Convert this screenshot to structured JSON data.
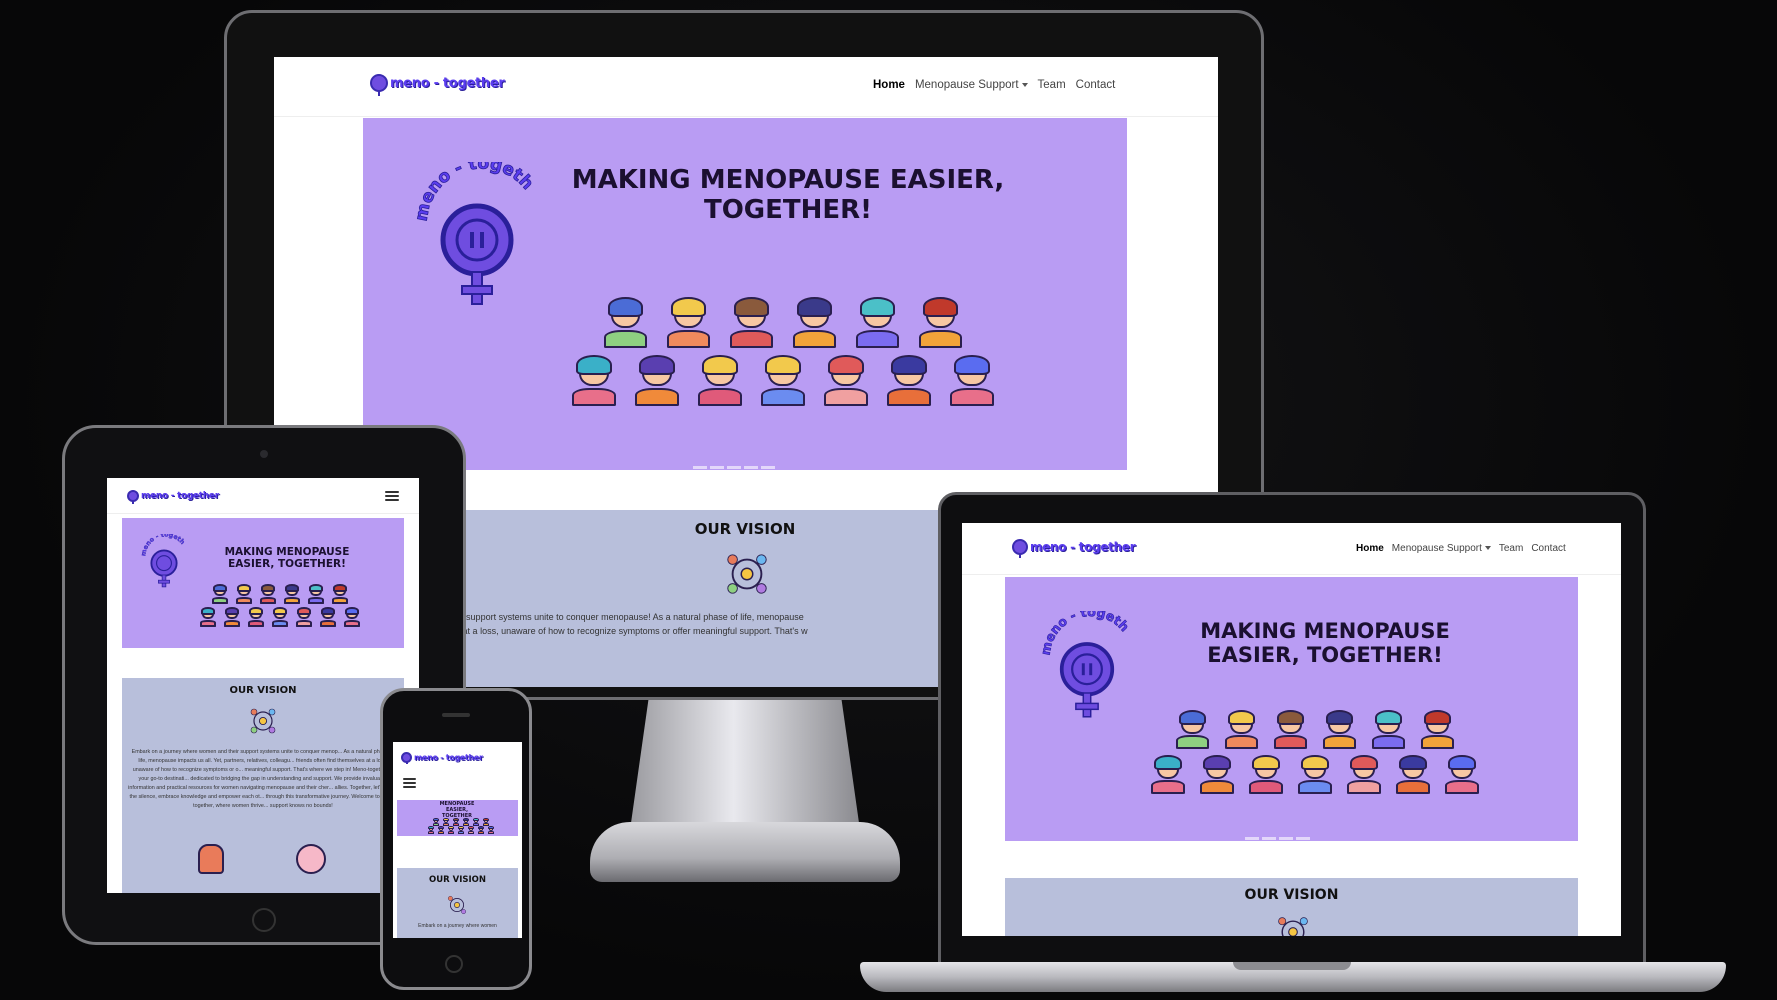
{
  "logo": {
    "text": "meno - together"
  },
  "nav": {
    "home": "Home",
    "support": "Menopause Support",
    "team": "Team",
    "contact": "Contact"
  },
  "hero": {
    "title_line1": "MAKING MENOPAUSE EASIER,",
    "title_line2": "TOGETHER!",
    "laptop_line1": "MAKING MENOPAUSE",
    "laptop_line2": "EASIER, TOGETHER!",
    "tablet_line1": "MAKING MENOPAUSE",
    "tablet_line2": "EASIER, TOGETHER!",
    "phone_line1": "MENOPAUSE",
    "phone_line2": "EASIER,",
    "phone_line3": "TOGETHER"
  },
  "vision": {
    "title": "OUR VISION",
    "desktop_text_1": "y where women and their support systems unite to conquer menopause! As a natural phase of life, menopause",
    "desktop_text_2": "ds often find themselves at a loss, unaware of how to recognize symptoms or offer meaningful support. That's w",
    "tablet_text": "Embark on a journey where women and their support systems unite to conquer menop... As a natural phase of life, menopause impacts us all. Yet, partners, relatives, colleagu... friends often find themselves at a loss, unaware of how to recognize symptoms or o... meaningful support. That's where we step in! Meno-together is your go-to destinati... dedicated to bridging the gap in understanding and support. We provide invaluab... information and practical resources for women navigating menopause and their cher... allies. Together, let's break the silence, embrace knowledge and empower each ot... through this transformative journey. Welcome to Meno-together, where women thrive... support knows no bounds!",
    "phone_text": "Embark on a journey where women"
  },
  "colors": {
    "hero_bg": "#b99cf3",
    "vision_bg": "#b8bfdb",
    "brand": "#5b3df0"
  },
  "icons": {
    "logo": "female-symbol-logo-icon",
    "emblem": "meno-together-emblem-icon",
    "vision": "community-circle-icon",
    "menu": "hamburger-menu-icon",
    "dropdown": "chevron-down-icon"
  }
}
